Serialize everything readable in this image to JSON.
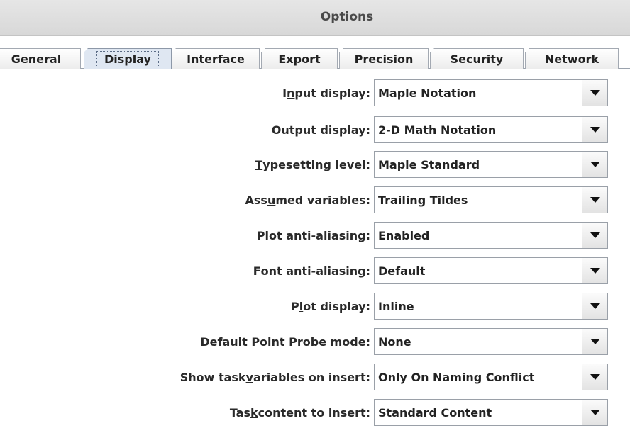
{
  "window": {
    "title": "Options"
  },
  "tabs": [
    {
      "label": "General",
      "mnemonic_index": 0
    },
    {
      "label": "Display",
      "mnemonic_index": 0,
      "active": true
    },
    {
      "label": "Interface",
      "mnemonic_index": 0
    },
    {
      "label": "Export",
      "mnemonic_index": -1
    },
    {
      "label": "Precision",
      "mnemonic_index": 0
    },
    {
      "label": "Security",
      "mnemonic_index": 0
    },
    {
      "label": "Network",
      "mnemonic_index": -1
    }
  ],
  "settings": [
    {
      "label": "Input display:",
      "mnemonic_index": 1,
      "value": "Maple Notation"
    },
    {
      "label": "Output display:",
      "mnemonic_index": 0,
      "value": "2-D Math Notation"
    },
    {
      "label": "Typesetting level:",
      "mnemonic_index": 0,
      "value": "Maple Standard"
    },
    {
      "label": "Assumed variables:",
      "mnemonic_index": 3,
      "value": "Trailing Tildes"
    },
    {
      "label": "Plot anti-aliasing:",
      "mnemonic_index": -1,
      "value": "Enabled"
    },
    {
      "label": "Font anti-aliasing:",
      "mnemonic_index": 0,
      "value": "Default"
    },
    {
      "label": "Plot display:",
      "mnemonic_index": 1,
      "value": "Inline"
    },
    {
      "label": "Default Point Probe mode:",
      "mnemonic_index": -1,
      "value": "None"
    },
    {
      "label": "Show task variables on insert:",
      "mnemonic_index": 10,
      "value": "Only On Naming Conflict"
    },
    {
      "label": "Task content to insert:",
      "mnemonic_index": 3,
      "value": "Standard Content"
    }
  ],
  "icons": {
    "dropdown": "chevron-down-icon"
  }
}
